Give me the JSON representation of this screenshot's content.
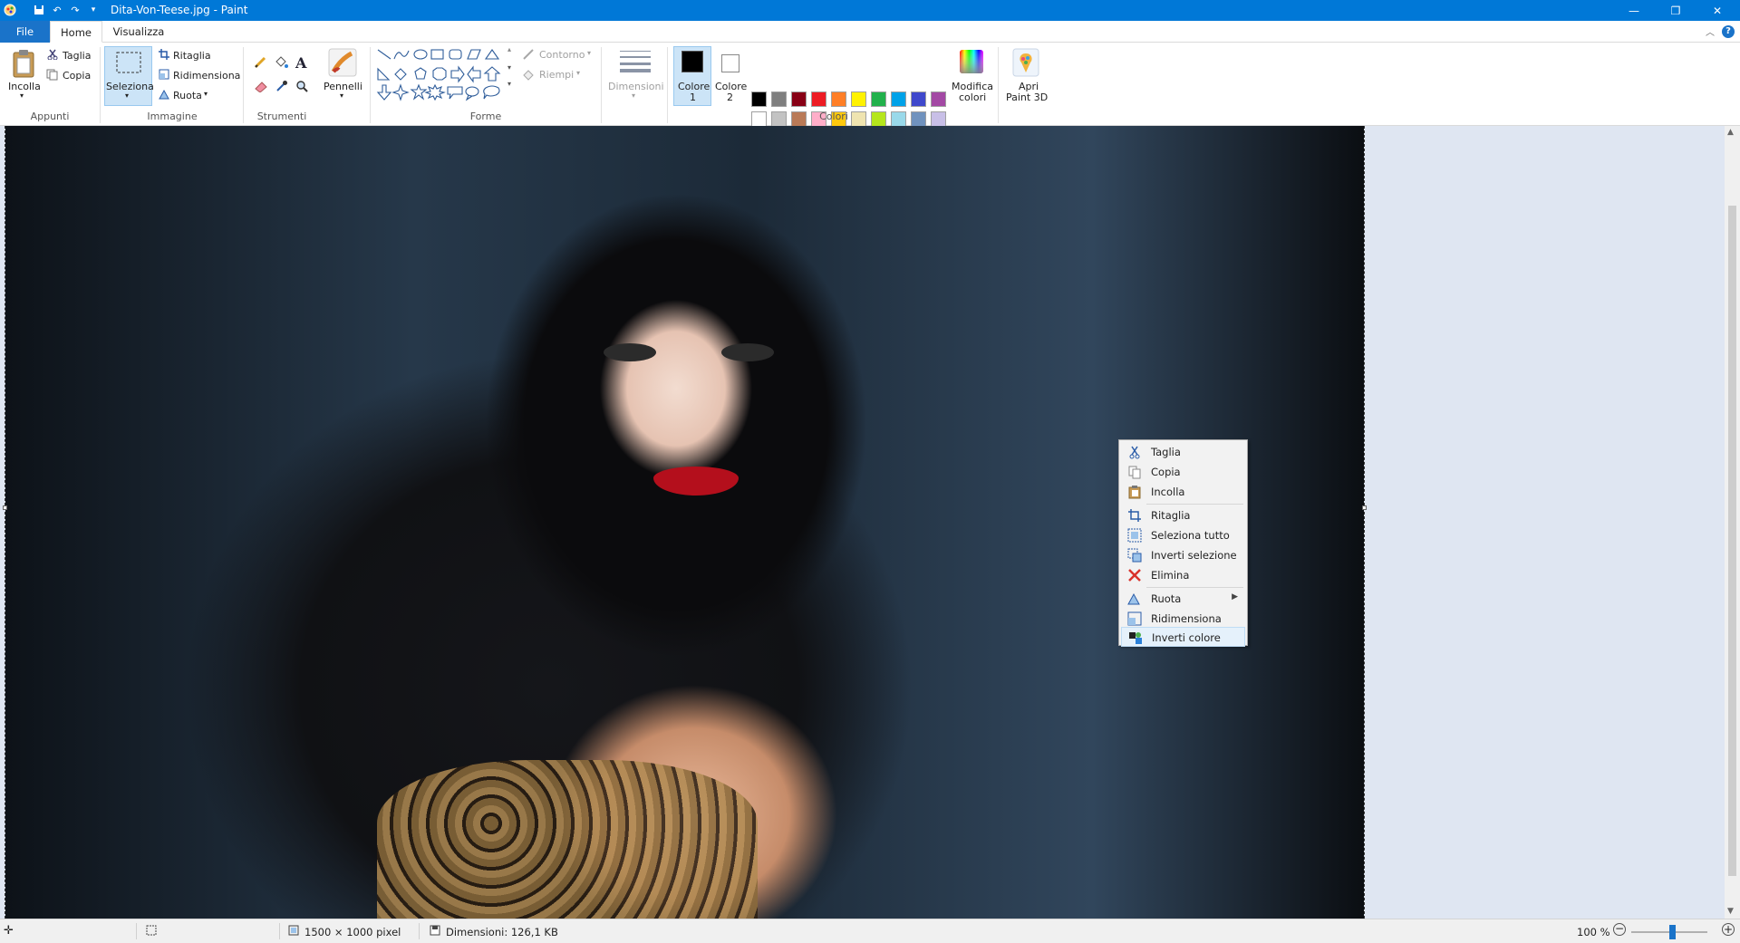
{
  "window": {
    "title": "Dita-Von-Teese.jpg - Paint",
    "minimize": "—",
    "restore": "❐",
    "close": "✕"
  },
  "ribbon_tabs": {
    "file": "File",
    "home": "Home",
    "view": "Visualizza"
  },
  "clipboard": {
    "paste": "Incolla",
    "cut": "Taglia",
    "copy": "Copia",
    "group": "Appunti"
  },
  "image": {
    "select": "Seleziona",
    "crop": "Ritaglia",
    "resize": "Ridimensiona",
    "rotate": "Ruota",
    "group": "Immagine"
  },
  "tools": {
    "group": "Strumenti"
  },
  "brushes": {
    "label": "Pennelli"
  },
  "shapes": {
    "outline": "Contorno",
    "fill": "Riempi",
    "group": "Forme"
  },
  "size": {
    "label": "Dimensioni"
  },
  "colors": {
    "color1_label": "Colore",
    "color1_num": "1",
    "color2_label": "Colore",
    "color2_num": "2",
    "edit_label": "Modifica",
    "edit_label2": "colori",
    "paint3d_label": "Apri",
    "paint3d_label2": "Paint 3D",
    "group": "Colori",
    "color1": "#000000",
    "color2": "#ffffff",
    "palette_row1": [
      "#000000",
      "#7f7f7f",
      "#880015",
      "#ed1c24",
      "#ff7f27",
      "#fff200",
      "#22b14c",
      "#00a2e8",
      "#3f48cc",
      "#a349a4"
    ],
    "palette_row2": [
      "#ffffff",
      "#c3c3c3",
      "#b97a57",
      "#ffaec9",
      "#ffc90e",
      "#efe4b0",
      "#b5e61d",
      "#99d9ea",
      "#7092be",
      "#c8bfe7"
    ],
    "palette_row3": [
      "#ffffff",
      "#ffffff",
      "#ffffff",
      "#ffffff",
      "#ffffff",
      "#ffffff",
      "#ffffff",
      "#ffffff",
      "#ffffff",
      "#ffffff"
    ]
  },
  "context_menu": {
    "items": [
      {
        "label": "Taglia",
        "icon": "scissors-icon"
      },
      {
        "label": "Copia",
        "icon": "copy-icon"
      },
      {
        "label": "Incolla",
        "icon": "paste-icon"
      },
      {
        "label": "Ritaglia",
        "icon": "crop-icon"
      },
      {
        "label": "Seleziona tutto",
        "icon": "select-all-icon"
      },
      {
        "label": "Inverti selezione",
        "icon": "invert-selection-icon"
      },
      {
        "label": "Elimina",
        "icon": "delete-icon"
      },
      {
        "label": "Ruota",
        "icon": "rotate-icon"
      },
      {
        "label": "Ridimensiona",
        "icon": "resize-icon"
      },
      {
        "label": "Inverti colore",
        "icon": "invert-color-icon"
      }
    ]
  },
  "statusbar": {
    "image_size": "1500 × 1000 pixel",
    "file_size": "Dimensioni: 126,1 KB",
    "zoom": "100 %"
  }
}
